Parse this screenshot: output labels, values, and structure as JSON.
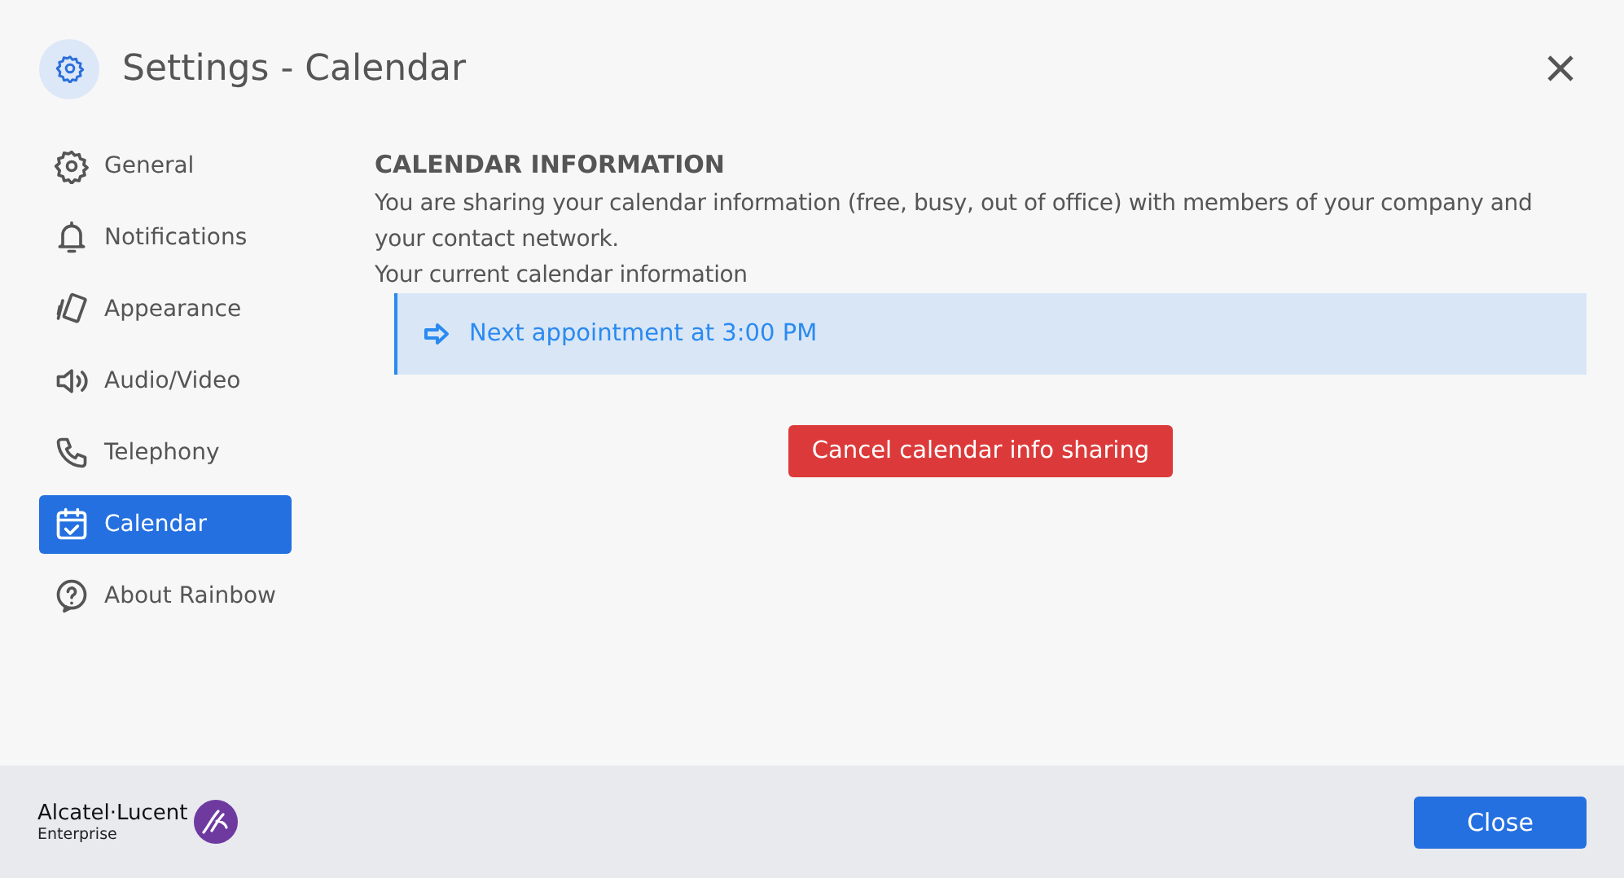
{
  "window": {
    "title": "Settings - Calendar"
  },
  "sidebar": {
    "items": [
      {
        "label": "General",
        "selected": false
      },
      {
        "label": "Notifications",
        "selected": false
      },
      {
        "label": "Appearance",
        "selected": false
      },
      {
        "label": "Audio/Video",
        "selected": false
      },
      {
        "label": "Telephony",
        "selected": false
      },
      {
        "label": "Calendar",
        "selected": true
      },
      {
        "label": "About Rainbow",
        "selected": false
      }
    ]
  },
  "content": {
    "heading": "CALENDAR INFORMATION",
    "description": "You are sharing your calendar information (free, busy, out of office) with members of your company and your contact network.",
    "current_label": "Your current calendar information",
    "info": "Next appointment at 3:00 PM",
    "action_button": "Cancel calendar info sharing"
  },
  "footer": {
    "logo_name": "Alcatel·Lucent",
    "logo_sub": "Enterprise",
    "close_button": "Close"
  }
}
